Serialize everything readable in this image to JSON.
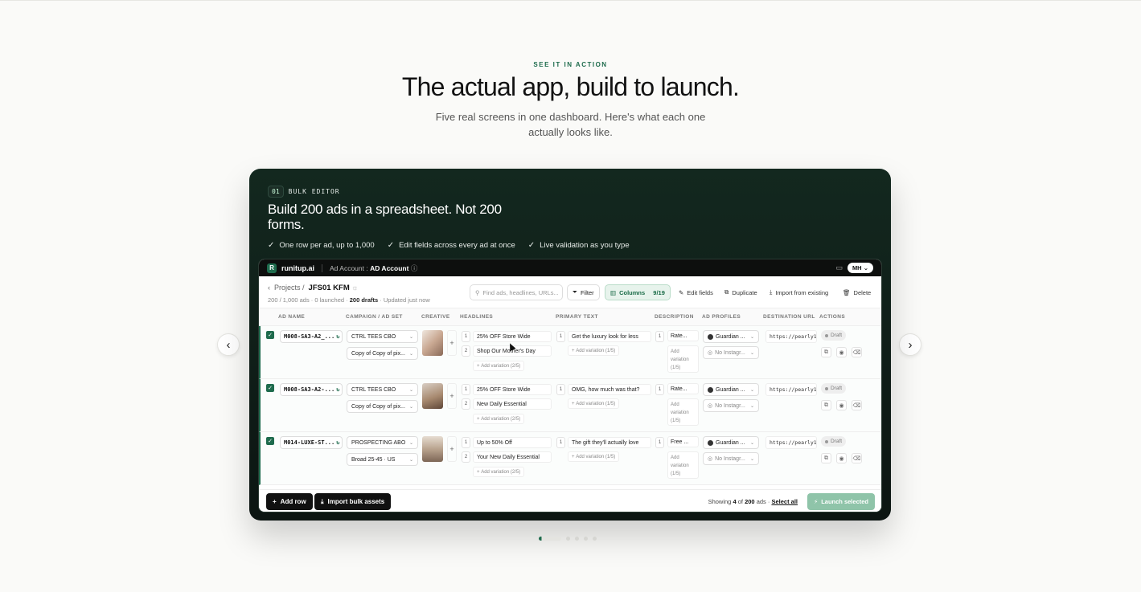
{
  "hero": {
    "eyebrow": "SEE IT IN ACTION",
    "title": "The actual app, build to launch.",
    "subtitle": "Five real screens in one dashboard. Here's what each one actually looks like."
  },
  "carousel": {
    "prev_icon": "‹",
    "next_icon": "›",
    "slide_count": 5,
    "active_slide": 1
  },
  "card": {
    "tag_number": "01",
    "tag_label": "BULK EDITOR",
    "title": "Build 200 ads in a spreadsheet. Not 200 forms.",
    "checks": [
      "One row per ad, up to 1,000",
      "Edit fields across every ad at once",
      "Live validation as you type"
    ]
  },
  "app": {
    "logo_letter": "R",
    "brand": "runitup.ai",
    "account_label": "Ad Account :",
    "account_name": "AD Account",
    "user_initials": "MH",
    "breadcrumb_parent": "Projects /",
    "project_name": "JFS01 KFM",
    "meta_counts": "200 / 1,000 ads · 0 launched ·",
    "meta_drafts": "200 drafts",
    "meta_updated": "· Updated just now",
    "search_placeholder": "Find ads, headlines, URLs...",
    "filter_label": "Filter",
    "columns_label": "Columns",
    "columns_count": "9/19",
    "edit_fields": "Edit fields",
    "duplicate": "Duplicate",
    "import_existing": "Import from existing",
    "delete": "Delete",
    "headers": [
      "AD NAME",
      "CAMPAIGN / AD SET",
      "CREATIVE",
      "HEADLINES",
      "PRIMARY TEXT",
      "DESCRIPTION",
      "AD PROFILES",
      "DESTINATION URL",
      "ACTIONS"
    ],
    "rows": [
      {
        "ad_name": "M008-SA3-A2_...",
        "campaign": "CTRL TEES CBO",
        "ad_set": "Copy of Copy of pix...",
        "headline1": "25% OFF Store Wide",
        "headline2": "Shop Our Mother's Day",
        "headline_add": "Add variation (2/5)",
        "primary": "Get the luxury look for less",
        "primary_add": "Add variation (1/5)",
        "description": "Rate...",
        "desc_add": "Add variation (1/5)",
        "profile": "Guardian ...",
        "instagram": "No Instagr...",
        "url": "https://pearly1",
        "status": "Draft"
      },
      {
        "ad_name": "M008-SA3-A2-...",
        "campaign": "CTRL TEES CBO",
        "ad_set": "Copy of Copy of pix...",
        "headline1": "25% OFF Store Wide",
        "headline2": "New Daily Essential",
        "headline_add": "Add variation (2/5)",
        "primary": "OMG, how much was that?",
        "primary_add": "Add variation (1/5)",
        "description": "Rate...",
        "desc_add": "Add variation (1/5)",
        "profile": "Guardian ...",
        "instagram": "No Instagr...",
        "url": "https://pearly1",
        "status": "Draft"
      },
      {
        "ad_name": "M014-LUXE-ST...",
        "campaign": "PROSPECTING ABO",
        "ad_set": "Broad 25-45 · US",
        "headline1": "Up to 50% Off",
        "headline2": "Your New Daily Essential",
        "headline_add": "Add variation (2/5)",
        "primary": "The gift they'll actually love",
        "primary_add": "Add variation (1/5)",
        "description": "Free ...",
        "desc_add": "Add variation (1/5)",
        "profile": "Guardian ...",
        "instagram": "No Instagr...",
        "url": "https://pearly1",
        "status": "Draft"
      }
    ],
    "footer": {
      "add_row": "Add row",
      "import_bulk": "Import bulk assets",
      "showing_prefix": "Showing",
      "showing_count": "4",
      "showing_of": "of",
      "showing_total": "200",
      "showing_suffix": "ads ·",
      "select_all": "Select all",
      "launch": "Launch selected"
    }
  },
  "colors": {
    "brand_green": "#1e6b4d",
    "card_dark": "#0c1512"
  }
}
